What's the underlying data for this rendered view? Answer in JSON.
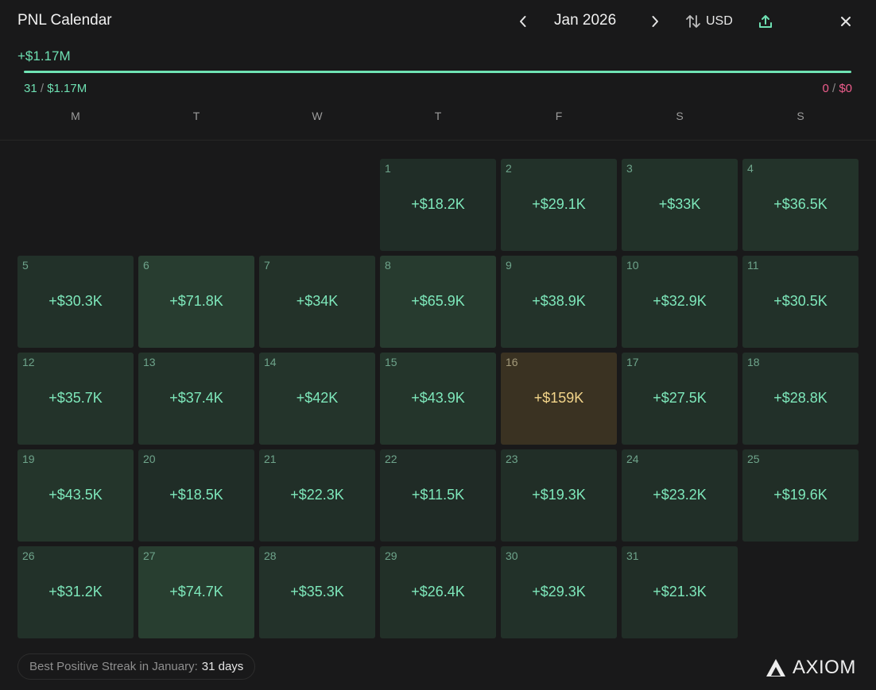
{
  "header": {
    "title": "PNL Calendar",
    "month": "Jan 2026",
    "currency": "USD",
    "prev_icon": "chevron-left-icon",
    "next_icon": "chevron-right-icon",
    "swap_icon": "swap-vertical-icon",
    "share_icon": "share-upload-icon",
    "close_icon": "close-icon"
  },
  "summary": {
    "total": "+$1.17M",
    "positive_days": "31",
    "positive_total": "$1.17M",
    "negative_days": "0",
    "negative_total": "$0",
    "separator": "/",
    "positive_share": 1.0
  },
  "weekdays": [
    "M",
    "T",
    "W",
    "T",
    "F",
    "S",
    "S"
  ],
  "first_weekday_index": 3,
  "days": [
    {
      "day": "1",
      "pnl": "+$18.2K",
      "value": 18.2
    },
    {
      "day": "2",
      "pnl": "+$29.1K",
      "value": 29.1
    },
    {
      "day": "3",
      "pnl": "+$33K",
      "value": 33
    },
    {
      "day": "4",
      "pnl": "+$36.5K",
      "value": 36.5
    },
    {
      "day": "5",
      "pnl": "+$30.3K",
      "value": 30.3
    },
    {
      "day": "6",
      "pnl": "+$71.8K",
      "value": 71.8
    },
    {
      "day": "7",
      "pnl": "+$34K",
      "value": 34
    },
    {
      "day": "8",
      "pnl": "+$65.9K",
      "value": 65.9
    },
    {
      "day": "9",
      "pnl": "+$38.9K",
      "value": 38.9
    },
    {
      "day": "10",
      "pnl": "+$32.9K",
      "value": 32.9
    },
    {
      "day": "11",
      "pnl": "+$30.5K",
      "value": 30.5
    },
    {
      "day": "12",
      "pnl": "+$35.7K",
      "value": 35.7
    },
    {
      "day": "13",
      "pnl": "+$37.4K",
      "value": 37.4
    },
    {
      "day": "14",
      "pnl": "+$42K",
      "value": 42
    },
    {
      "day": "15",
      "pnl": "+$43.9K",
      "value": 43.9
    },
    {
      "day": "16",
      "pnl": "+$159K",
      "value": 159,
      "highlight": true
    },
    {
      "day": "17",
      "pnl": "+$27.5K",
      "value": 27.5
    },
    {
      "day": "18",
      "pnl": "+$28.8K",
      "value": 28.8
    },
    {
      "day": "19",
      "pnl": "+$43.5K",
      "value": 43.5
    },
    {
      "day": "20",
      "pnl": "+$18.5K",
      "value": 18.5
    },
    {
      "day": "21",
      "pnl": "+$22.3K",
      "value": 22.3
    },
    {
      "day": "22",
      "pnl": "+$11.5K",
      "value": 11.5
    },
    {
      "day": "23",
      "pnl": "+$19.3K",
      "value": 19.3
    },
    {
      "day": "24",
      "pnl": "+$23.2K",
      "value": 23.2
    },
    {
      "day": "25",
      "pnl": "+$19.6K",
      "value": 19.6
    },
    {
      "day": "26",
      "pnl": "+$31.2K",
      "value": 31.2
    },
    {
      "day": "27",
      "pnl": "+$74.7K",
      "value": 74.7
    },
    {
      "day": "28",
      "pnl": "+$35.3K",
      "value": 35.3
    },
    {
      "day": "29",
      "pnl": "+$26.4K",
      "value": 26.4
    },
    {
      "day": "30",
      "pnl": "+$29.3K",
      "value": 29.3
    },
    {
      "day": "31",
      "pnl": "+$21.3K",
      "value": 21.3
    }
  ],
  "footer": {
    "streak_label": "Best Positive Streak in January:",
    "streak_value": "31 days",
    "brand": "AXIOM",
    "brand_icon": "axiom-logo-icon"
  },
  "colors": {
    "positive": "#6ee0b2",
    "negative": "#ee5d8c",
    "highlight_bg": "#3a3222",
    "highlight_text": "#f3d58a"
  }
}
